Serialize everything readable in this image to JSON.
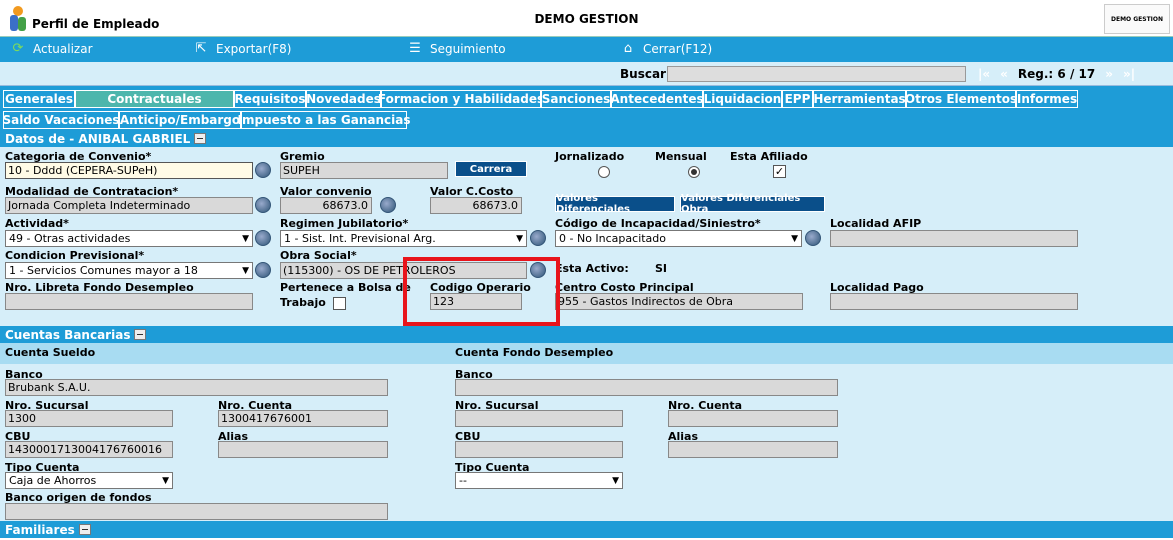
{
  "header": {
    "app_title": "Perfil de Empleado",
    "company": "DEMO GESTION",
    "logo_text": "DEMO GESTION"
  },
  "toolbar": {
    "actualizar": "Actualizar",
    "exportar": "Exportar(F8)",
    "seguimiento": "Seguimiento",
    "cerrar": "Cerrar(F12)"
  },
  "search": {
    "label": "Buscar",
    "value": "",
    "first": "|«",
    "prev": "«",
    "record": "Reg.: 6 / 17",
    "next": "»",
    "last": "»|"
  },
  "tabs_row1": [
    "Generales",
    "Contractuales",
    "Requisitos",
    "Novedades",
    "Formacion y Habilidades",
    "Sanciones",
    "Antecedentes",
    "Liquidacion",
    "EPP",
    "Herramientas",
    "Otros Elementos",
    "Informes"
  ],
  "tabs_row2": [
    "Saldo Vacaciones",
    "Anticipo/Embargo",
    "Impuesto a las Ganancias"
  ],
  "active_tab": "Contractuales",
  "datos": {
    "title": "Datos de - ANIBAL GABRIEL",
    "categoria_label": "Categoria de Convenio*",
    "categoria_value": "10 - Dddd (CEPERA-SUPeH)",
    "gremio_label": "Gremio",
    "gremio_value": "SUPEH",
    "carrera_btn": "Carrera",
    "jornalizado_label": "Jornalizado",
    "mensual_label": "Mensual",
    "afiliado_label": "Esta Afiliado",
    "modalidad_label": "Modalidad de Contratacion*",
    "modalidad_value": "Jornada Completa Indeterminado",
    "valor_convenio_label": "Valor convenio",
    "valor_convenio_value": "68673.0",
    "valor_costo_label": "Valor C.Costo",
    "valor_costo_value": "68673.0",
    "valores_dif_btn": "Valores Diferenciales",
    "valores_dif_obra_btn": "Valores Diferenciales Obra",
    "actividad_label": "Actividad*",
    "actividad_value": "49 - Otras actividades",
    "regimen_label": "Regimen Jubilatorio*",
    "regimen_value": "1 - Sist. Int. Previsional Arg.",
    "incapacidad_label": "Código de Incapacidad/Siniestro*",
    "incapacidad_value": "0 - No Incapacitado",
    "localidad_afip_label": "Localidad AFIP",
    "localidad_afip_value": "",
    "condicion_label": "Condicion Previsional*",
    "condicion_value": "1 - Servicios Comunes mayor a 18",
    "obra_label": "Obra Social*",
    "obra_value": "(115300) -  OS DE  PETROLEROS",
    "activo_label": "Esta Activo:",
    "activo_value": "SI",
    "libreta_label": "Nro. Libreta Fondo Desempleo",
    "libreta_value": "",
    "bolsa_label": "Pertenece a Bolsa de",
    "bolsa_label2": "Trabajo",
    "codigo_operario_label": "Codigo Operario",
    "codigo_operario_value": "123",
    "centro_costo_label": "Centro Costo Principal",
    "centro_costo_value": "955 - Gastos Indirectos de Obra",
    "localidad_pago_label": "Localidad Pago",
    "localidad_pago_value": ""
  },
  "cuentas": {
    "title": "Cuentas Bancarias",
    "sueldo_title": "Cuenta Sueldo",
    "fondo_title": "Cuenta Fondo Desempleo",
    "banco_label": "Banco",
    "banco_value": "Brubank S.A.U.",
    "banco2_value": "",
    "sucursal_label": "Nro. Sucursal",
    "sucursal_value": "1300",
    "sucursal2_value": "",
    "cuenta_label": "Nro. Cuenta",
    "cuenta_value": "1300417676001",
    "cuenta2_value": "",
    "cbu_label": "CBU",
    "cbu_value": "1430001713004176760016",
    "cbu2_value": "",
    "alias_label": "Alias",
    "alias_value": "",
    "alias2_value": "",
    "tipo_label": "Tipo Cuenta",
    "tipo_value": "Caja de Ahorros",
    "tipo2_value": "--",
    "origen_label": "Banco origen de fondos",
    "origen_value": ""
  },
  "familiares": {
    "title": "Familiares"
  }
}
